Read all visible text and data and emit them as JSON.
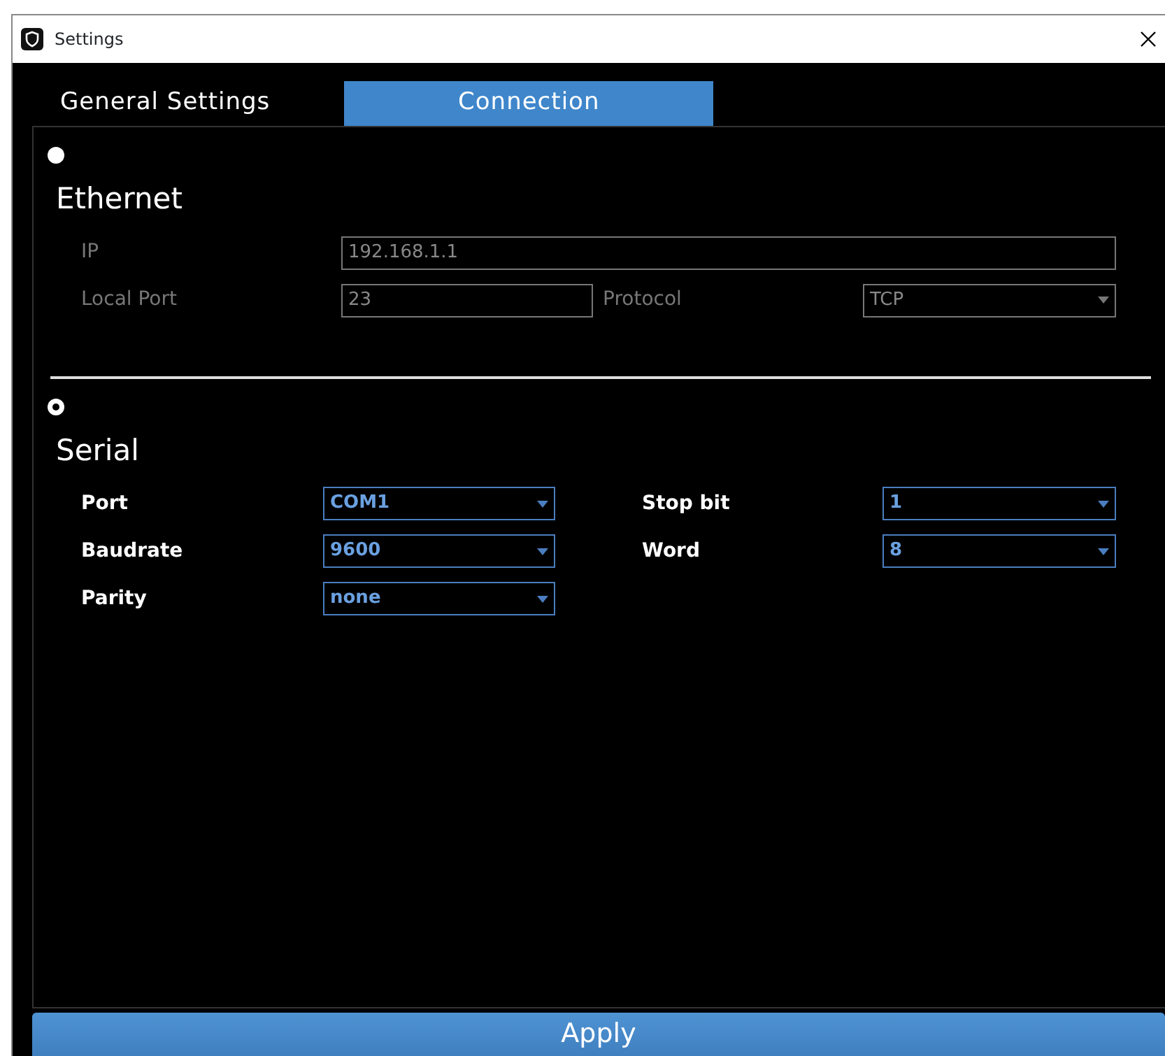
{
  "window": {
    "title": "Settings"
  },
  "tabs": [
    {
      "label": "General Settings",
      "selected": false
    },
    {
      "label": "Connection",
      "selected": true
    }
  ],
  "sections": [
    {
      "title": "Ethernet",
      "selected": false,
      "disabled": true,
      "rows": [
        [
          {
            "label": "IP",
            "kind": "text",
            "value": "192.168.1.1"
          }
        ],
        [
          {
            "label": "Local Port",
            "kind": "text",
            "value": "23"
          },
          {
            "label": "Protocol",
            "kind": "combo",
            "value": "TCP"
          }
        ]
      ]
    },
    {
      "title": "Serial",
      "selected": true,
      "disabled": false,
      "rows": [
        [
          {
            "label": "Port",
            "kind": "combo",
            "value": "COM1"
          },
          {
            "label": "Stop bit",
            "kind": "combo",
            "value": "1"
          }
        ],
        [
          {
            "label": "Baudrate",
            "kind": "combo",
            "value": "9600"
          },
          {
            "label": "Word",
            "kind": "combo",
            "value": "8"
          }
        ],
        [
          {
            "label": "Parity",
            "kind": "combo",
            "value": "none"
          }
        ]
      ]
    }
  ],
  "apply_button": "Apply"
}
